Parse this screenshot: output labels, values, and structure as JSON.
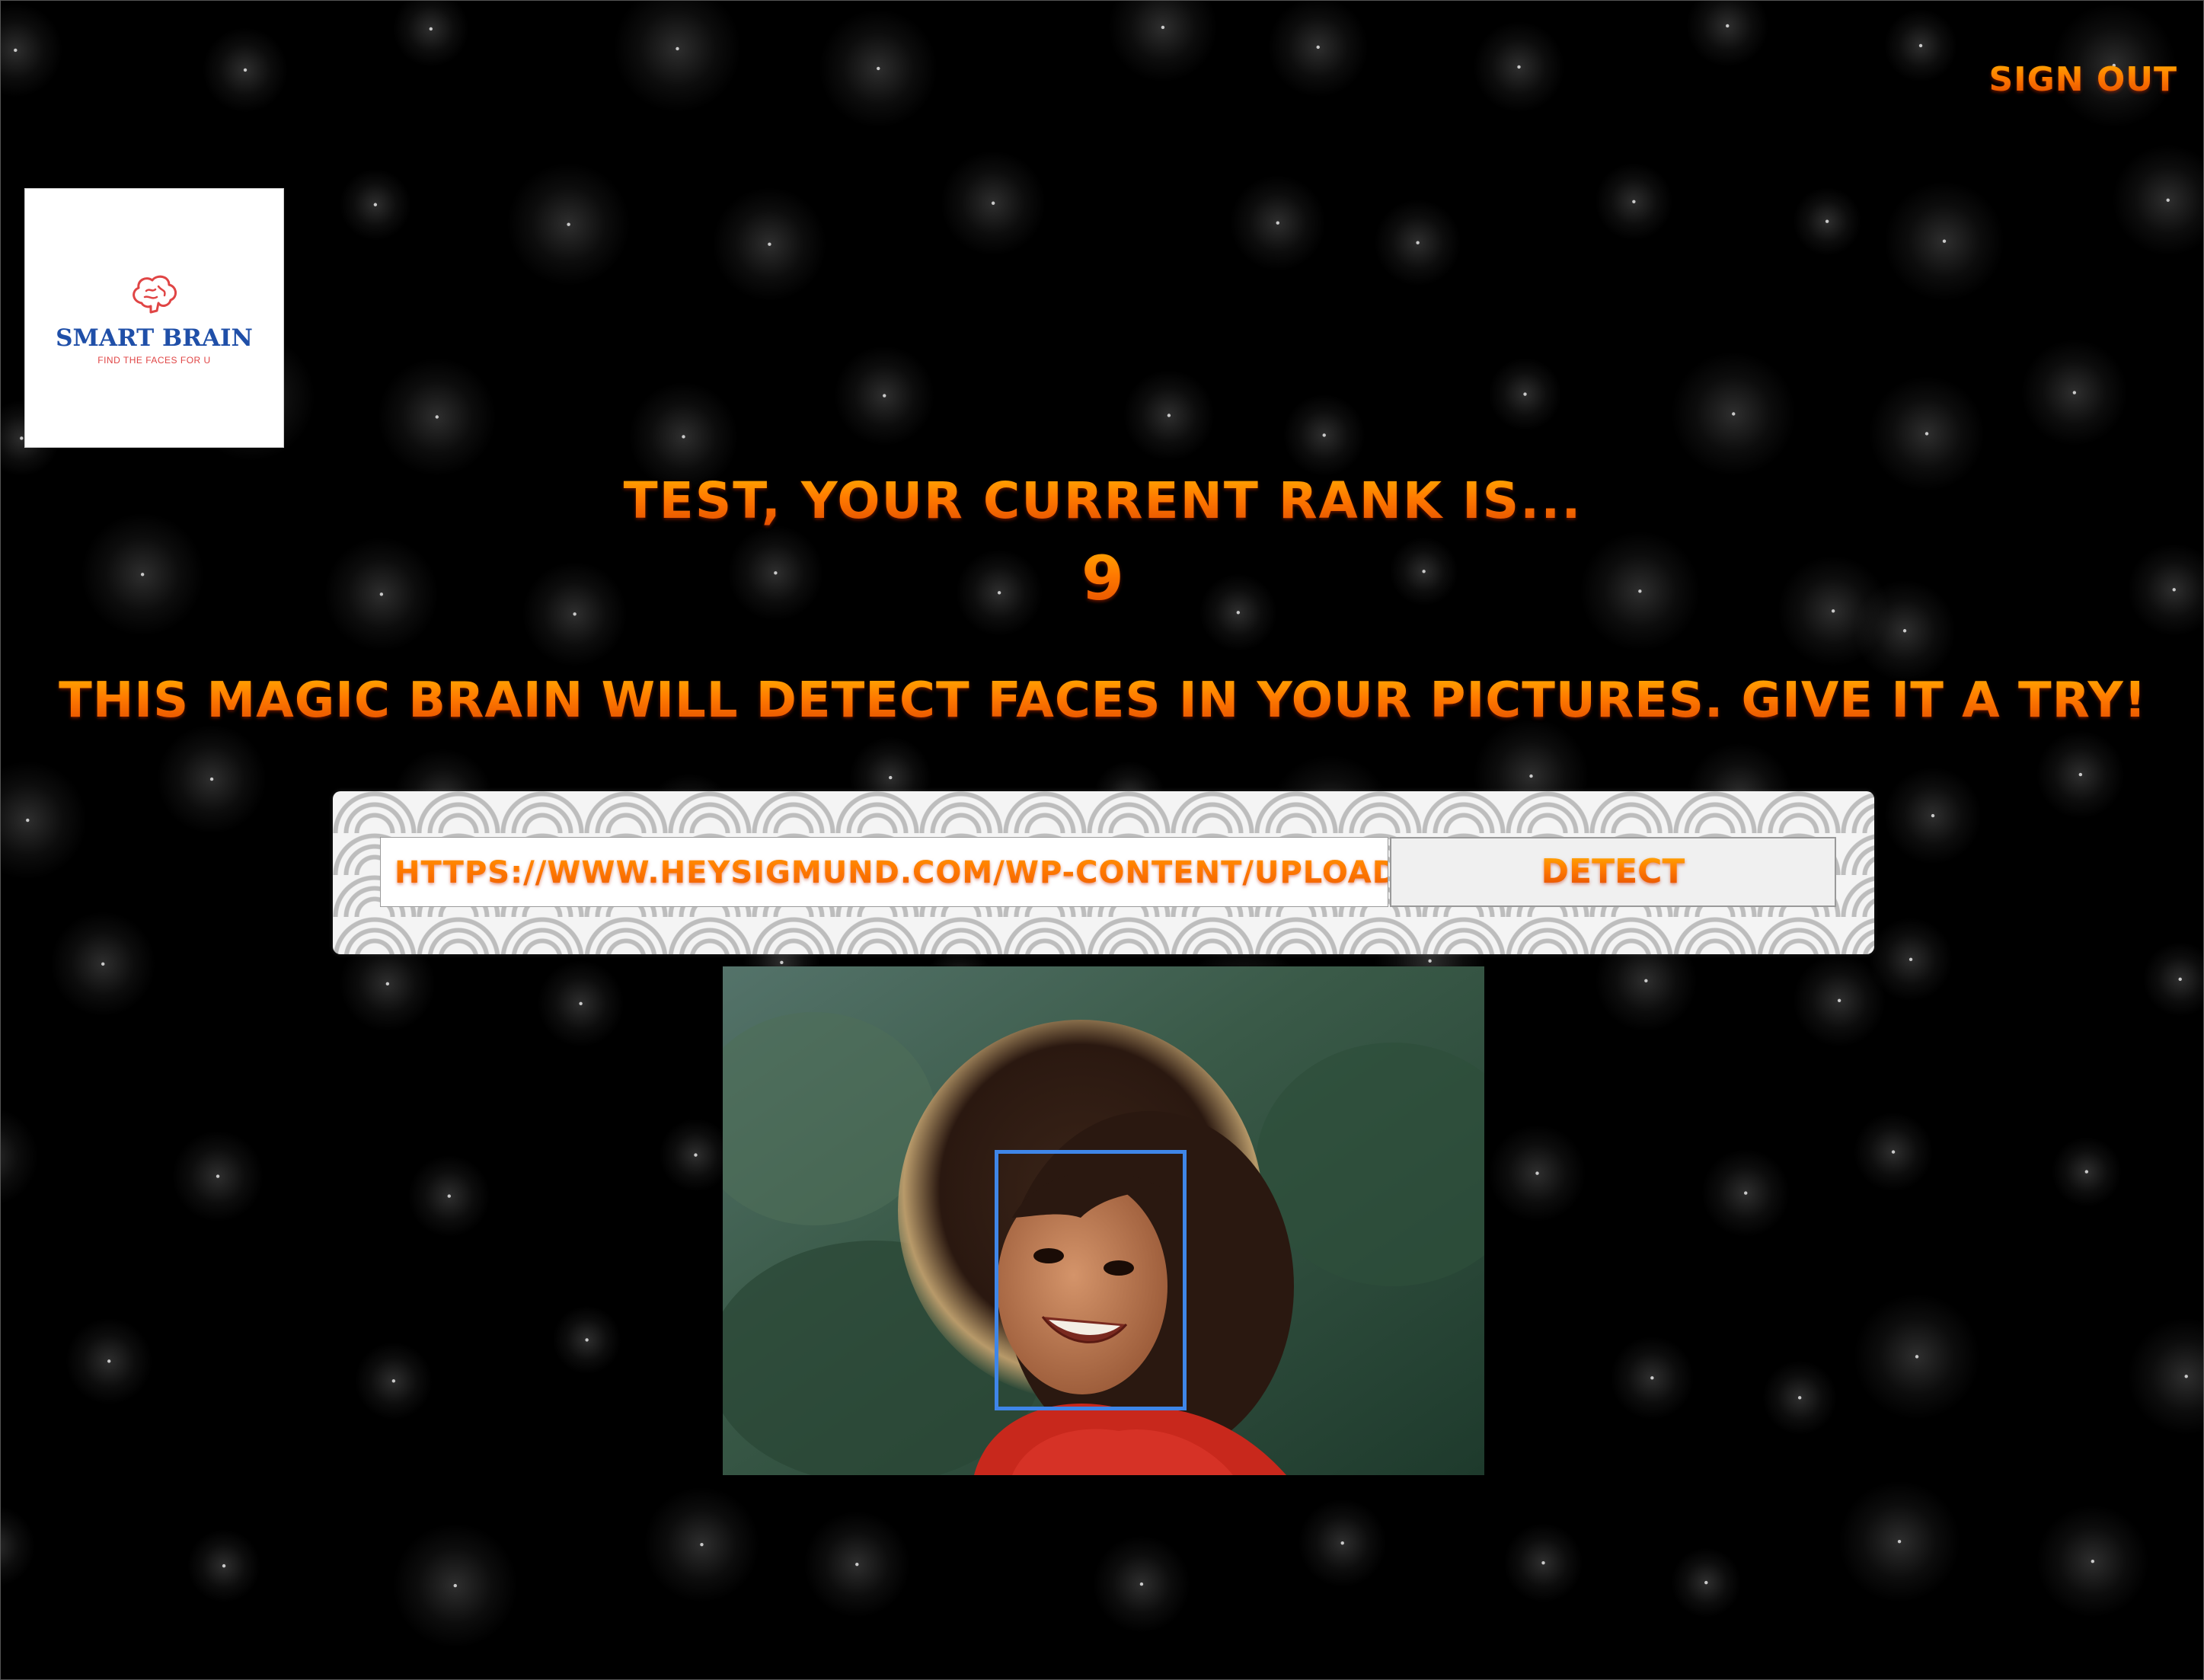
{
  "header": {
    "sign_out_label": "Sign Out"
  },
  "logo": {
    "brand": "SMART BRAIN",
    "tagline": "FIND THE FACES FOR U",
    "icon": "brain-icon"
  },
  "rank": {
    "message": "Test, your current rank is...",
    "value": "9"
  },
  "intro": {
    "text": "This Magic Brain will detect faces in your pictures. Give it a try!"
  },
  "form": {
    "url_value": "https://www.heysigmund.com/wp-content/uploads/buil",
    "detect_label": "Detect"
  },
  "result": {
    "image_alt": "Photo of smiling child with curly hair",
    "face_box_color": "#3f86e8"
  },
  "colors": {
    "background": "#000000",
    "text_gradient_top": "#ffb000",
    "text_gradient_bottom": "#e04800",
    "face_box": "#3f86e8",
    "logo_brand": "#1f4fa8",
    "logo_accent": "#e04545"
  }
}
